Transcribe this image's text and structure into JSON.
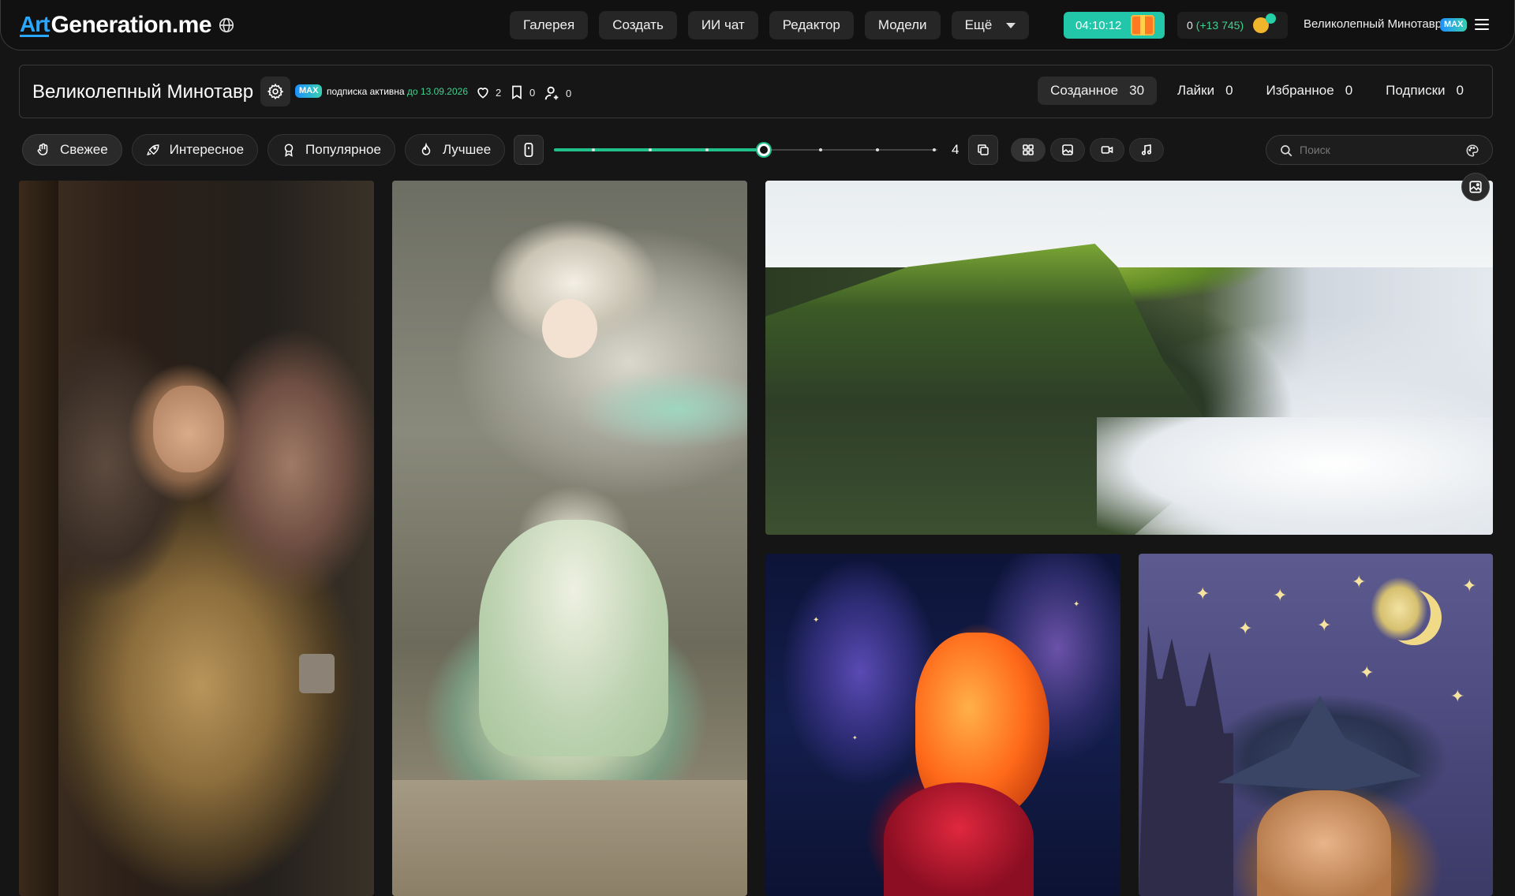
{
  "header": {
    "logo_art": "Art",
    "logo_text": "Generation.me",
    "nav": [
      {
        "label": "Галерея"
      },
      {
        "label": "Создать"
      },
      {
        "label": "ИИ чат"
      },
      {
        "label": "Редактор"
      },
      {
        "label": "Модели"
      },
      {
        "label": "Ещё"
      }
    ],
    "timer": "04:10:12",
    "coins": "0",
    "coins_bonus": "(+13 745)",
    "user_name": "Великолепный Минотавр",
    "badge": "MAX"
  },
  "profile": {
    "name": "Великолепный Минотавр",
    "badge": "MAX",
    "subscription_text": "подписка активна",
    "subscription_until": "до 13.09.2026",
    "likes": "2",
    "bookmarks": "0",
    "followers": "0",
    "tabs": [
      {
        "label": "Созданное",
        "count": "30",
        "active": true
      },
      {
        "label": "Лайки",
        "count": "0"
      },
      {
        "label": "Избранное",
        "count": "0"
      },
      {
        "label": "Подписки",
        "count": "0"
      }
    ]
  },
  "filters": {
    "items": [
      {
        "label": "Свежее",
        "icon": "hand-wave-icon",
        "active": true
      },
      {
        "label": "Интересное",
        "icon": "rocket-icon"
      },
      {
        "label": "Популярное",
        "icon": "award-icon"
      },
      {
        "label": "Лучшее",
        "icon": "flame-icon"
      }
    ],
    "columns_value": "4",
    "columns_min": 1,
    "columns_max": 7,
    "search_placeholder": "Поиск"
  },
  "gallery": [
    {
      "subject": "moth-girl"
    },
    {
      "subject": "dragon-girl"
    },
    {
      "subject": "cliff-above-clouds"
    },
    {
      "subject": "fire-fairy"
    },
    {
      "subject": "witch"
    }
  ],
  "colors": {
    "accent_green": "#1fc08a",
    "timer_bg": "#21c7a8",
    "logo_blue": "#2aa8ff"
  }
}
